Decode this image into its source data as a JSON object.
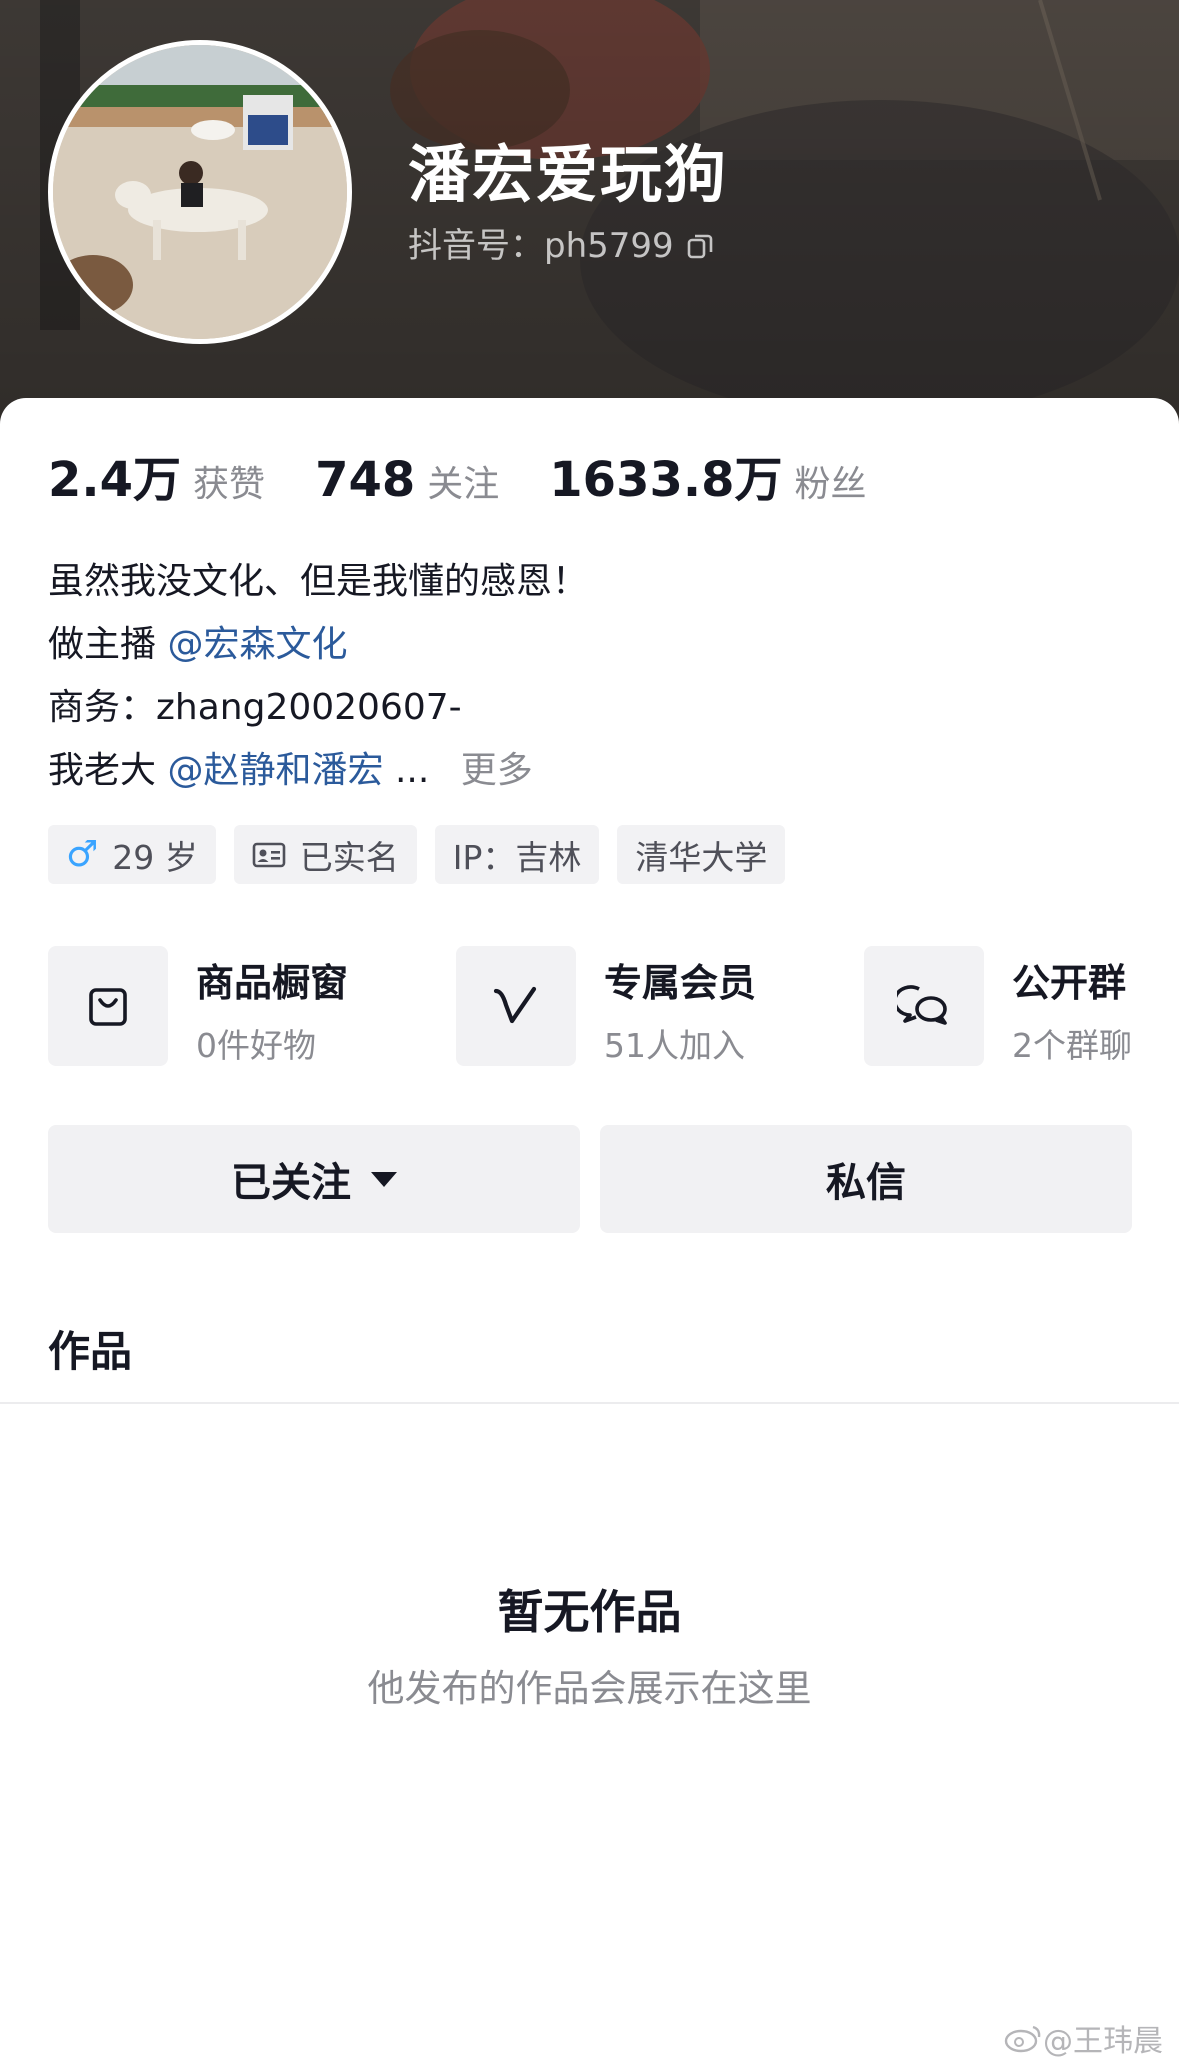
{
  "profile": {
    "nickname": "潘宏爱玩狗",
    "douyin_id": "抖音号：ph5799",
    "avatar": "boy-with-dog-photo"
  },
  "stats": [
    {
      "value": "2.4万",
      "label": "获赞"
    },
    {
      "value": "748",
      "label": "关注"
    },
    {
      "value": "1633.8万",
      "label": "粉丝"
    }
  ],
  "bio": {
    "line1": "虽然我没文化、但是我懂的感恩！",
    "line2_prefix": "做主播",
    "line2_mention": "@宏森文化",
    "line3": "商务：zhang20020607-",
    "line4_prefix": "我老大",
    "line4_mention": "@赵静和潘宏",
    "ellipsis": "...",
    "more": "更多"
  },
  "tags": {
    "gender_symbol": "♂",
    "age": "29 岁",
    "verified": "已实名",
    "ip": "IP：吉林",
    "school": "清华大学"
  },
  "features": [
    {
      "title": "商品橱窗",
      "sub": "0件好物",
      "icon": "shopping-bag-icon"
    },
    {
      "title": "专属会员",
      "sub": "51人加入",
      "icon": "v-member-icon"
    },
    {
      "title": "公开群",
      "sub": "2个群聊",
      "icon": "chat-bubbles-icon"
    }
  ],
  "actions": {
    "followed": "已关注",
    "message": "私信"
  },
  "works": {
    "tab": "作品",
    "empty_title": "暂无作品",
    "empty_sub": "他发布的作品会展示在这里"
  },
  "watermark": "@王玮晨",
  "colors": {
    "mention": "#2b5a9b",
    "gender": "#3aa4ff",
    "chip_bg": "#f2f2f4",
    "muted_text": "#8a8b91"
  }
}
